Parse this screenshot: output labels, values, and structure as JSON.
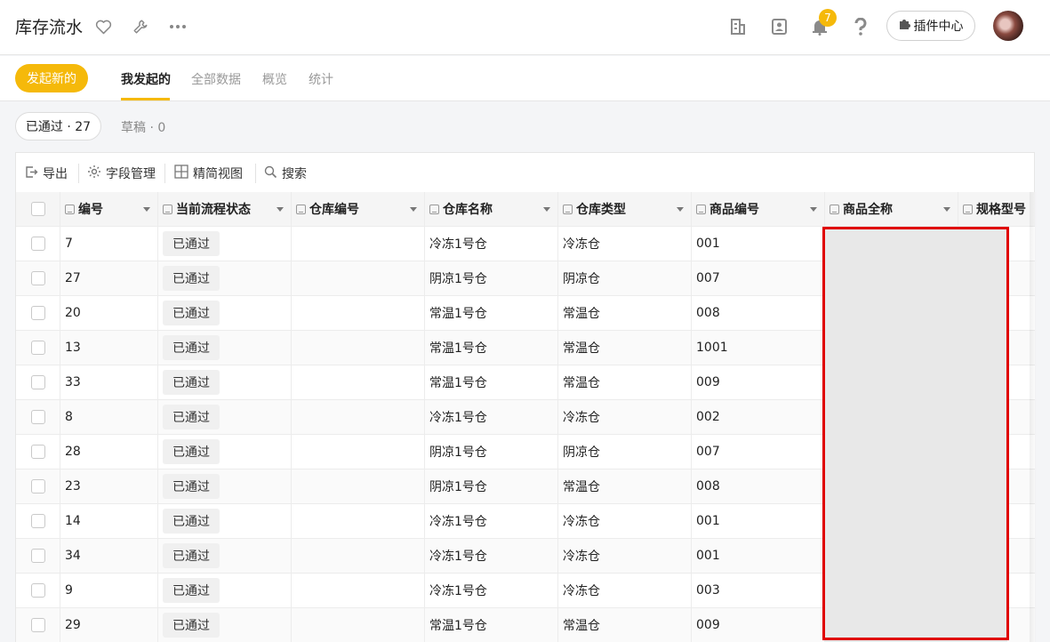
{
  "app": {
    "title": "库存流水",
    "notification_count": "7",
    "plugin_center": "插件中心"
  },
  "tabs": {
    "new_button": "发起新的",
    "items": [
      "我发起的",
      "全部数据",
      "概览",
      "统计"
    ]
  },
  "filters": {
    "approved": "已通过 · 27",
    "draft": "草稿 · 0"
  },
  "toolbar": {
    "export": "导出",
    "field_manage": "字段管理",
    "compact_view": "精简视图",
    "search": "搜索"
  },
  "table": {
    "columns": [
      "编号",
      "当前流程状态",
      "仓库编号",
      "仓库名称",
      "仓库类型",
      "商品编号",
      "商品全称",
      "规格型号"
    ],
    "rows": [
      {
        "id": "7",
        "status": "已通过",
        "wh_code": "",
        "wh_name": "冷冻1号仓",
        "wh_type": "冷冻仓",
        "sku": "001"
      },
      {
        "id": "27",
        "status": "已通过",
        "wh_code": "",
        "wh_name": "阴凉1号仓",
        "wh_type": "阴凉仓",
        "sku": "007"
      },
      {
        "id": "20",
        "status": "已通过",
        "wh_code": "",
        "wh_name": "常温1号仓",
        "wh_type": "常温仓",
        "sku": "008"
      },
      {
        "id": "13",
        "status": "已通过",
        "wh_code": "",
        "wh_name": "常温1号仓",
        "wh_type": "常温仓",
        "sku": "1001"
      },
      {
        "id": "33",
        "status": "已通过",
        "wh_code": "",
        "wh_name": "常温1号仓",
        "wh_type": "常温仓",
        "sku": "009"
      },
      {
        "id": "8",
        "status": "已通过",
        "wh_code": "",
        "wh_name": "冷冻1号仓",
        "wh_type": "冷冻仓",
        "sku": "002"
      },
      {
        "id": "28",
        "status": "已通过",
        "wh_code": "",
        "wh_name": "阴凉1号仓",
        "wh_type": "阴凉仓",
        "sku": "007"
      },
      {
        "id": "23",
        "status": "已通过",
        "wh_code": "",
        "wh_name": "阴凉1号仓",
        "wh_type": "常温仓",
        "sku": "008"
      },
      {
        "id": "14",
        "status": "已通过",
        "wh_code": "",
        "wh_name": "冷冻1号仓",
        "wh_type": "冷冻仓",
        "sku": "001"
      },
      {
        "id": "34",
        "status": "已通过",
        "wh_code": "",
        "wh_name": "冷冻1号仓",
        "wh_type": "冷冻仓",
        "sku": "001"
      },
      {
        "id": "9",
        "status": "已通过",
        "wh_code": "",
        "wh_name": "冷冻1号仓",
        "wh_type": "冷冻仓",
        "sku": "003"
      },
      {
        "id": "29",
        "status": "已通过",
        "wh_code": "",
        "wh_name": "常温1号仓",
        "wh_type": "常温仓",
        "sku": "009"
      }
    ]
  },
  "colors": {
    "accent": "#f5b90a",
    "highlight_border": "#e00000"
  }
}
